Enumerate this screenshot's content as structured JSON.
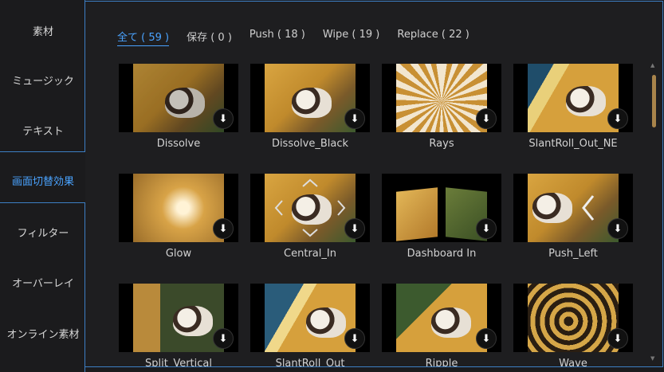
{
  "sidebar": {
    "items": [
      {
        "label": "素材"
      },
      {
        "label": "ミュージック"
      },
      {
        "label": "テキスト"
      },
      {
        "label": "画面切替効果",
        "active": true
      },
      {
        "label": "フィルター"
      },
      {
        "label": "オーバーレイ"
      },
      {
        "label": "オンライン素材"
      }
    ]
  },
  "tabs": [
    {
      "label": "全て ( 59 )",
      "active": true
    },
    {
      "label": "保存 ( 0 )"
    },
    {
      "label": "Push ( 18 )"
    },
    {
      "label": "Wipe ( 19 )"
    },
    {
      "label": "Replace ( 22 )"
    }
  ],
  "effects": [
    {
      "label": "Dissolve"
    },
    {
      "label": "Dissolve_Black"
    },
    {
      "label": "Rays"
    },
    {
      "label": "SlantRoll_Out_NE"
    },
    {
      "label": "Glow"
    },
    {
      "label": "Central_In"
    },
    {
      "label": "Dashboard In"
    },
    {
      "label": "Push_Left"
    },
    {
      "label": "Split_Vertical"
    },
    {
      "label": "SlantRoll_Out"
    },
    {
      "label": "Ripple"
    },
    {
      "label": "Wave"
    }
  ],
  "icons": {
    "download": "download-icon"
  },
  "colors": {
    "accent": "#4aa3ff",
    "border": "#3d7fc4",
    "scroll_thumb": "#a8844b"
  }
}
